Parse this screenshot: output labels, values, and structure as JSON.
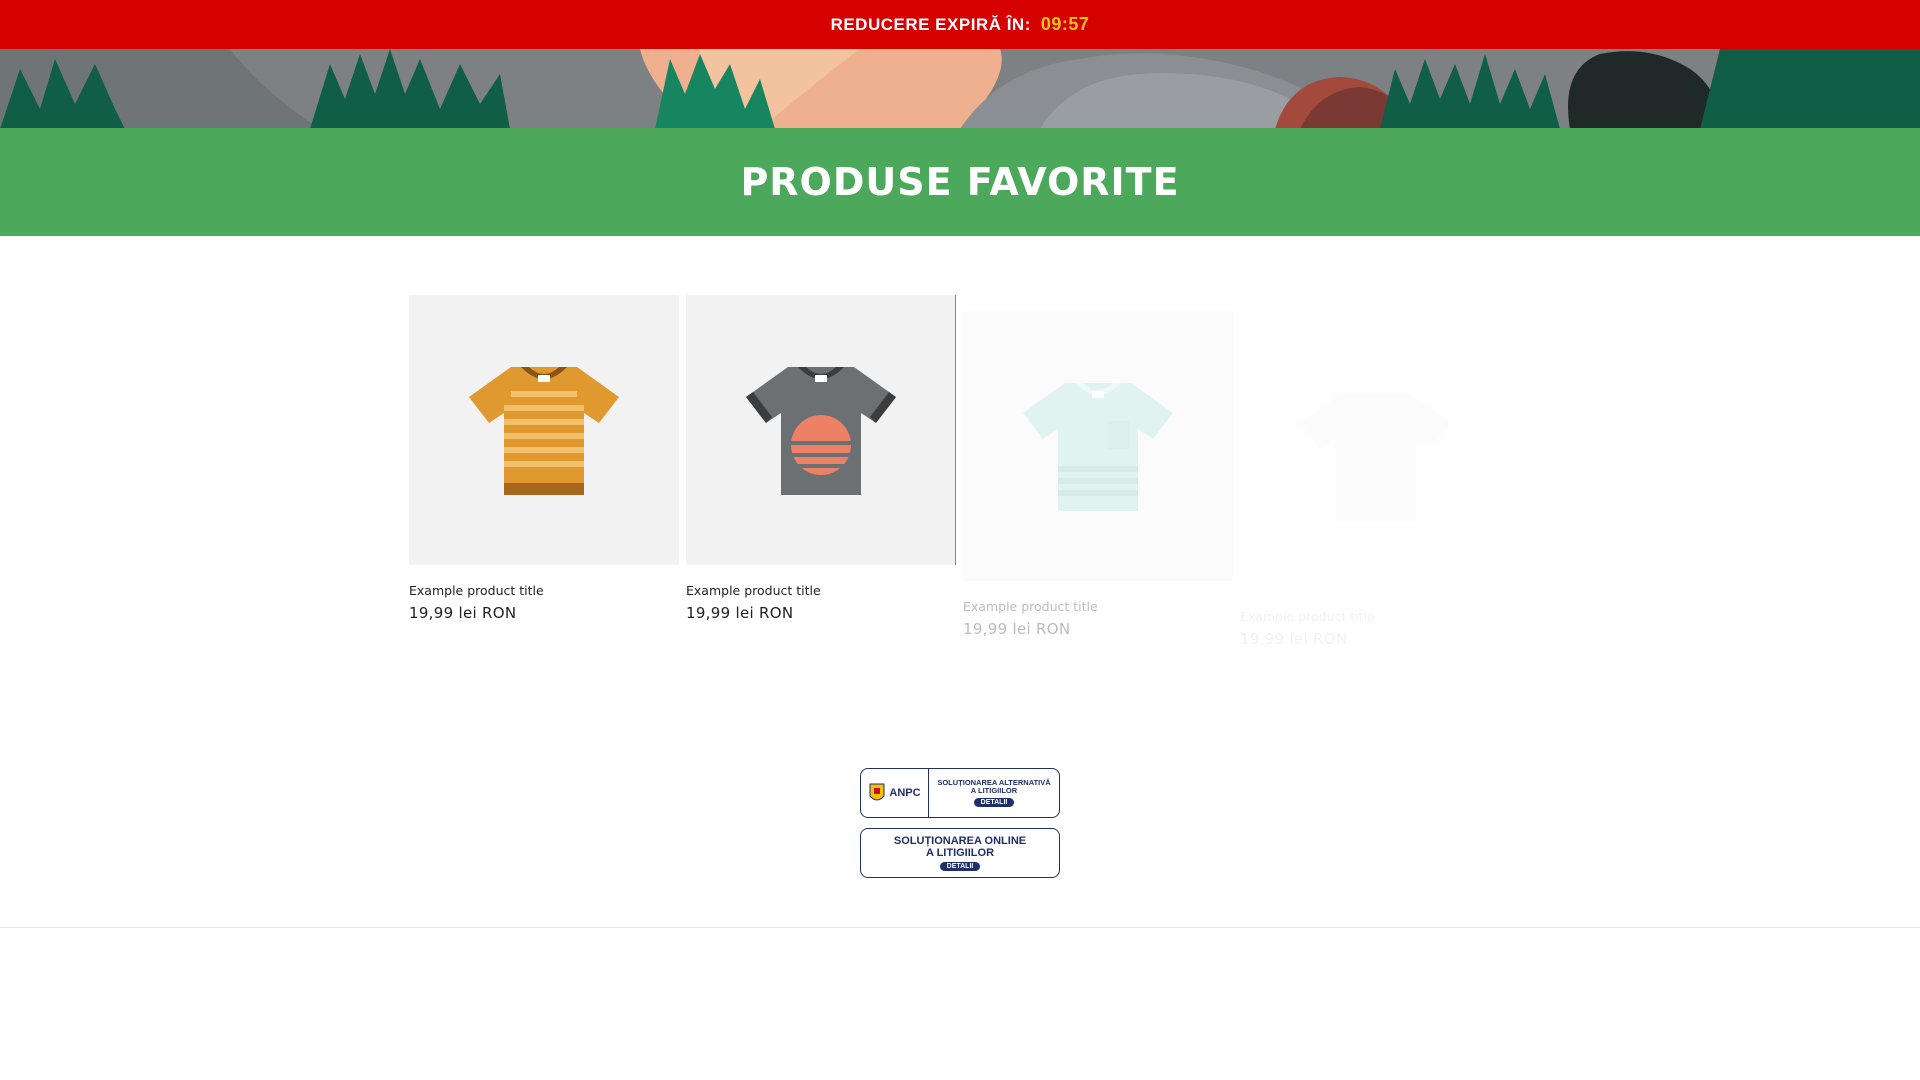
{
  "topbar": {
    "label": "REDUCERE EXPIRĂ ÎN:",
    "timer": "09:57",
    "bg_color": "#d50000",
    "timer_color": "#f5c518"
  },
  "hero": {
    "title": "PRODUSE FAVORITE",
    "band_color": "#4ca85b"
  },
  "products": [
    {
      "title": "Example product title",
      "price": "19,99 lei RON",
      "icon": "orange-striped-tshirt-icon"
    },
    {
      "title": "Example product title",
      "price": "19,99 lei RON",
      "icon": "gray-sunset-tshirt-icon"
    },
    {
      "title": "Example product title",
      "price": "19,99 lei RON",
      "icon": "mint-pocket-tshirt-icon"
    },
    {
      "title": "Example product title",
      "price": "19,99 lei RON",
      "icon": "tshirt-icon"
    }
  ],
  "badges": {
    "sal": {
      "seal": "ANPC",
      "line1": "SOLUȚIONAREA ALTERNATIVĂ",
      "line2": "A LITIGIILOR",
      "details": "DETALII"
    },
    "sol": {
      "line1": "SOLUȚIONAREA ONLINE",
      "line2": "A LITIGIILOR",
      "details": "DETALII"
    },
    "color": "#1f2f6b"
  }
}
